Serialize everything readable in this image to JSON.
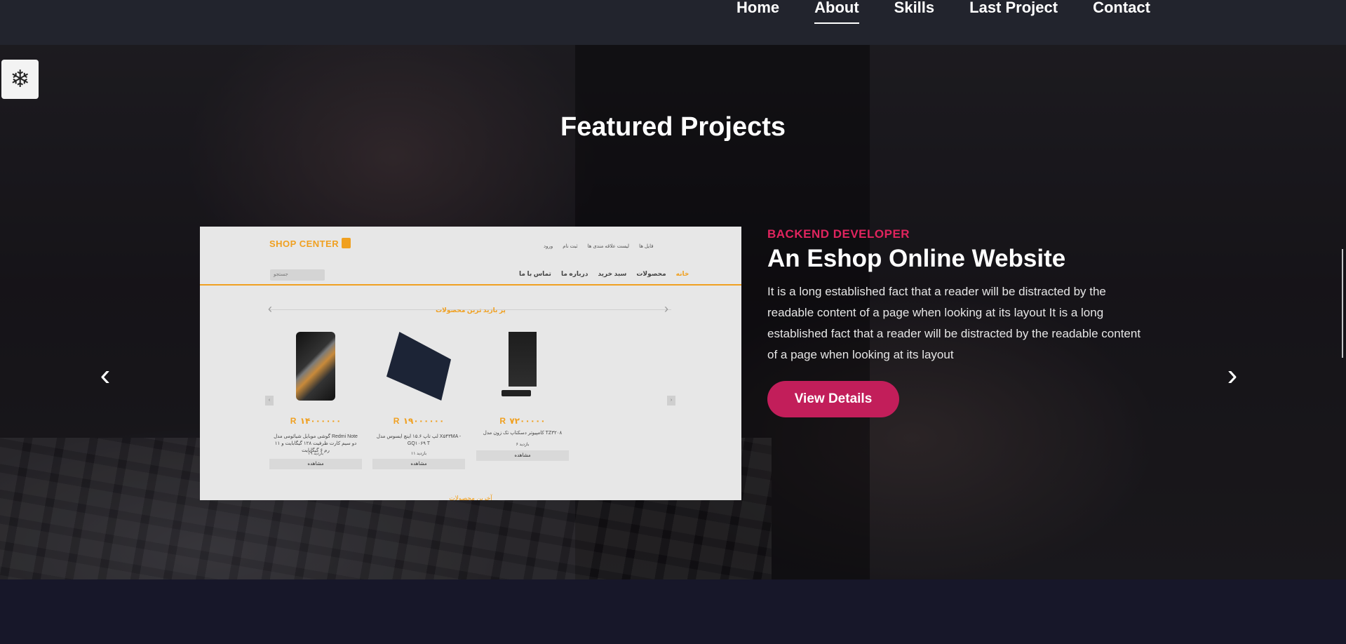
{
  "nav": {
    "items": [
      {
        "label": "Home"
      },
      {
        "label": "About"
      },
      {
        "label": "Skills"
      },
      {
        "label": "Last Project"
      },
      {
        "label": "Contact"
      }
    ],
    "active": "About"
  },
  "featured": {
    "title": "Featured Projects",
    "project": {
      "role": "BACKEND DEVELOPER",
      "title": "An Eshop Online Website",
      "description": "It is a long established fact that a reader will be distracted by the readable content of a page when looking at its layout It is a long established fact that a reader will be distracted by the readable content of a page when looking at its layout",
      "button": "View Details"
    }
  },
  "shot": {
    "logo": "SHOP CENTER",
    "topmenu": [
      "ورود",
      "ثبت نام",
      "لیست علاقه مندی ها",
      "فایل ها"
    ],
    "search_placeholder": "جستجو",
    "mainmenu": [
      "خانه",
      "محصولات",
      "سبد خرید",
      "درباره ما",
      "تماس با ما"
    ],
    "slider_title": "پر بازید ترین محصولات",
    "products": [
      {
        "price": "R ۱۴۰۰۰۰۰۰",
        "desc": "گوشی موبایل شیائومی مدل Redmi Note ۱۱ دو سیم کارت ظرفیت ۱۲۸ گیگابایت و رم ۶ گیگابایت",
        "stock": "۱۹ بازدید",
        "button": "مشاهده"
      },
      {
        "price": "R ۱۹۰۰۰۰۰۰",
        "desc": "لپ تاپ ۱۵.۶ اینچ ایسوس مدل X۵۴۳MA - GQ۱۰۶۹ T",
        "stock": "۱۱ بازدید",
        "button": "مشاهده"
      },
      {
        "price": "R ۷۲۰۰۰۰۰",
        "desc": "کامپیوتر دسکتاپ تک زون مدل TZ۳۲۰۸",
        "stock": "۶ بازدید",
        "button": "مشاهده"
      }
    ],
    "bottom_tag": "آخرین محصولات"
  },
  "icons": {
    "snow": "snowflake-icon",
    "prev": "chevron-left-icon",
    "next": "chevron-right-icon"
  },
  "colors": {
    "accent": "#c21e5a",
    "role": "#e0245e",
    "navbar": "#22242d"
  }
}
